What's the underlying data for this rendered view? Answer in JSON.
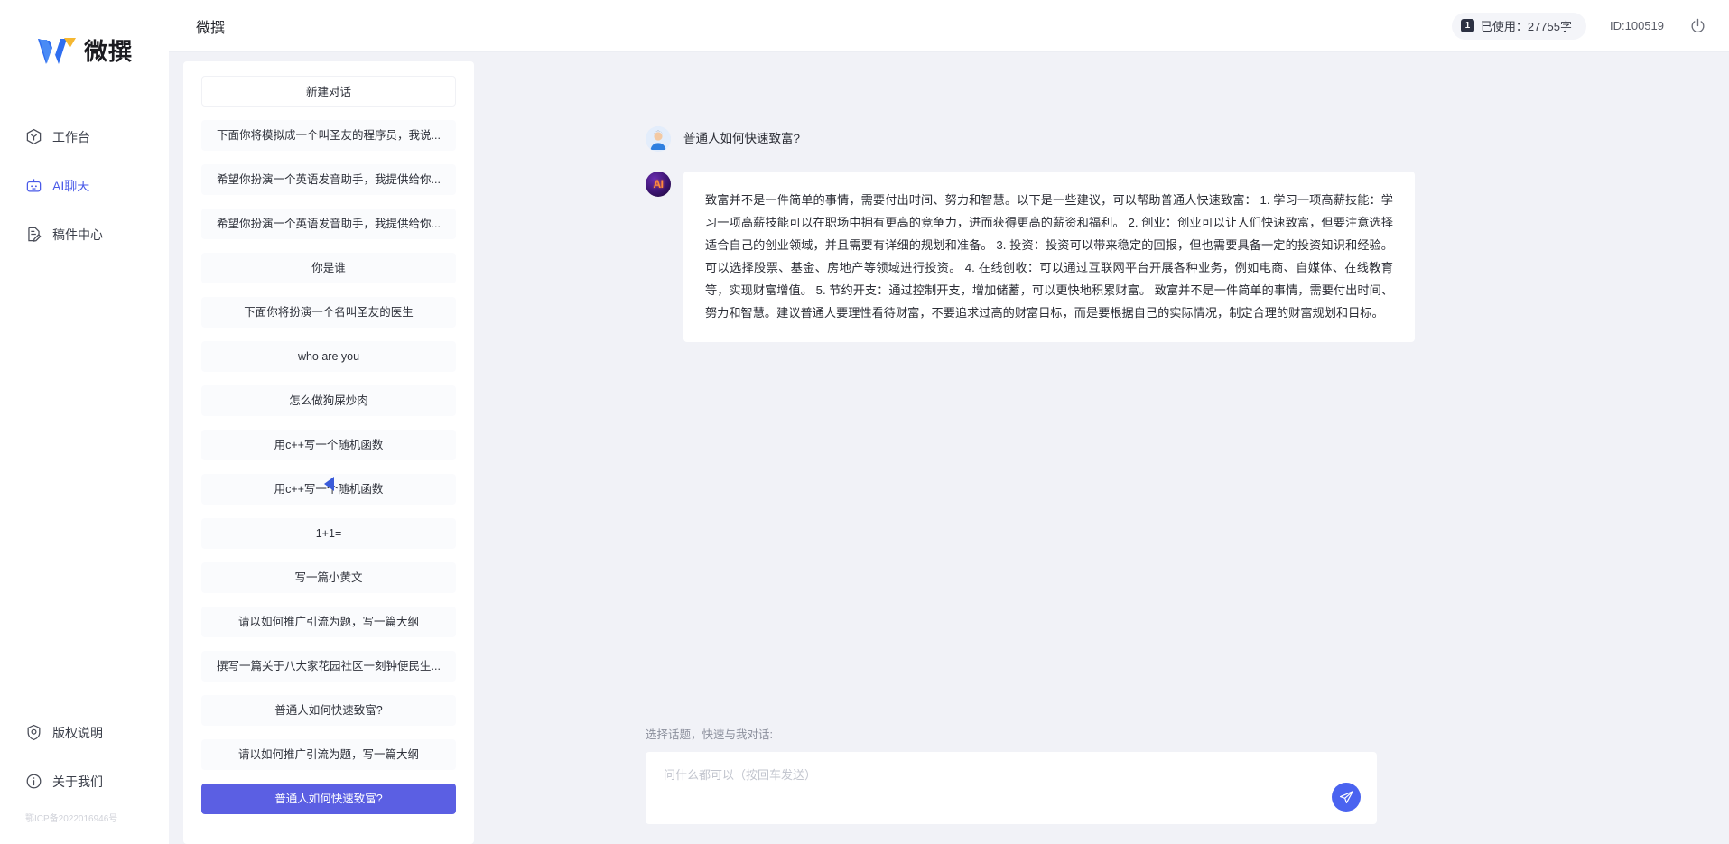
{
  "brand": {
    "logo_text": "微撰",
    "logo_icon": "w-logo-icon"
  },
  "sidebar": {
    "items": [
      {
        "label": "工作台",
        "icon": "workbench-icon",
        "active": false
      },
      {
        "label": "AI聊天",
        "icon": "ai-chat-icon",
        "active": true
      },
      {
        "label": "稿件中心",
        "icon": "document-center-icon",
        "active": false
      }
    ],
    "bottom_items": [
      {
        "label": "版权说明",
        "icon": "shield-icon"
      },
      {
        "label": "关于我们",
        "icon": "info-icon"
      }
    ],
    "icp": "鄂ICP备2022016946号"
  },
  "topbar": {
    "title": "微撰",
    "usage_badge": "1",
    "usage_label": "已使用：27755字",
    "user_id": "ID:100519",
    "power_icon": "power-icon"
  },
  "conversations": {
    "new_chat_label": "新建对话",
    "items": [
      {
        "label": "下面你将模拟成一个叫圣友的程序员，我说...",
        "selected": false
      },
      {
        "label": "希望你扮演一个英语发音助手，我提供给你...",
        "selected": false
      },
      {
        "label": "希望你扮演一个英语发音助手，我提供给你...",
        "selected": false
      },
      {
        "label": "你是谁",
        "selected": false
      },
      {
        "label": "下面你将扮演一个名叫圣友的医生",
        "selected": false
      },
      {
        "label": "who are you",
        "selected": false
      },
      {
        "label": "怎么做狗屎炒肉",
        "selected": false
      },
      {
        "label": "用c++写一个随机函数",
        "selected": false
      },
      {
        "label": "用c++写一个随机函数",
        "selected": false
      },
      {
        "label": "1+1=",
        "selected": false
      },
      {
        "label": "写一篇小黄文",
        "selected": false
      },
      {
        "label": "请以如何推广引流为题，写一篇大纲",
        "selected": false
      },
      {
        "label": "撰写一篇关于八大家花园社区一刻钟便民生...",
        "selected": false
      },
      {
        "label": "普通人如何快速致富?",
        "selected": false
      },
      {
        "label": "请以如何推广引流为题，写一篇大纲",
        "selected": false
      },
      {
        "label": "普通人如何快速致富?",
        "selected": true
      }
    ],
    "collapse_icon": "collapse-left-icon"
  },
  "chat": {
    "messages": [
      {
        "role": "user",
        "avatar_icon": "user-avatar-icon",
        "text": "普通人如何快速致富?"
      },
      {
        "role": "assistant",
        "avatar_icon": "ai-avatar-icon",
        "avatar_text": "AI",
        "text": "致富并不是一件简单的事情，需要付出时间、努力和智慧。以下是一些建议，可以帮助普通人快速致富： 1. 学习一项高薪技能：学习一项高薪技能可以在职场中拥有更高的竞争力，进而获得更高的薪资和福利。 2. 创业：创业可以让人们快速致富，但要注意选择适合自己的创业领域，并且需要有详细的规划和准备。 3. 投资：投资可以带来稳定的回报，但也需要具备一定的投资知识和经验。可以选择股票、基金、房地产等领域进行投资。 4. 在线创收：可以通过互联网平台开展各种业务，例如电商、自媒体、在线教育等，实现财富增值。 5. 节约开支：通过控制开支，增加储蓄，可以更快地积累财富。 致富并不是一件简单的事情，需要付出时间、努力和智慧。建议普通人要理性看待财富，不要追求过高的财富目标，而是要根据自己的实际情况，制定合理的财富规划和目标。"
      }
    ]
  },
  "composer": {
    "hint": "选择话题，快速与我对话:",
    "placeholder": "问什么都可以（按回车发送）",
    "send_icon": "send-plane-icon"
  },
  "colors": {
    "accent": "#5b5fe3",
    "send_blue": "#4a63f0",
    "logo_blue": "#2f6ef0",
    "logo_yellow": "#f5b731",
    "page_bg": "#f1f2f7"
  }
}
